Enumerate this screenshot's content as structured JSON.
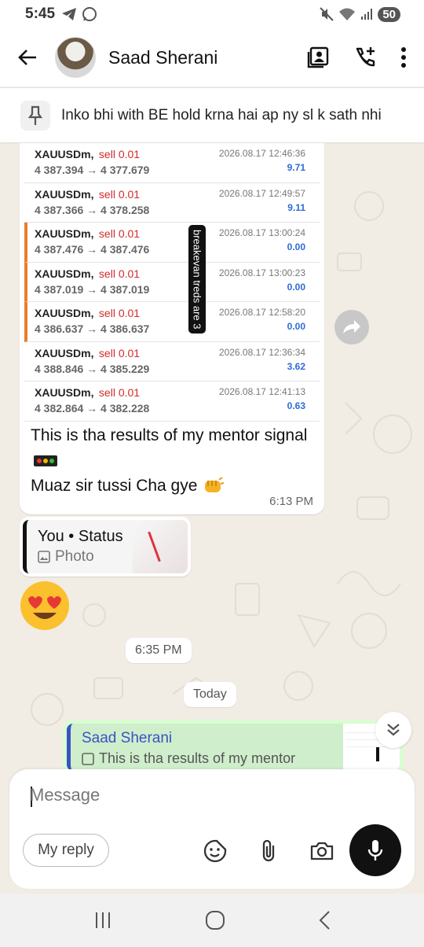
{
  "status_bar": {
    "time": "5:45",
    "battery": "50"
  },
  "header": {
    "contact_name": "Saad Sherani"
  },
  "pinned": {
    "text": "Inko bhi with BE hold krna hai ap ny sl k sath nhi"
  },
  "trades": [
    {
      "symbol": "XAUUSDm,",
      "side": "sell 0.01",
      "prices": "4 387.394 → 4 377.679",
      "date": "2026.08.17 12:46:36",
      "pnl": "9.71",
      "breakeven": false
    },
    {
      "symbol": "XAUUSDm,",
      "side": "sell 0.01",
      "prices": "4 387.366 → 4 378.258",
      "date": "2026.08.17 12:49:57",
      "pnl": "9.11",
      "breakeven": false
    },
    {
      "symbol": "XAUUSDm,",
      "side": "sell 0.01",
      "prices": "4 387.476 → 4 387.476",
      "date": "2026.08.17 13:00:24",
      "pnl": "0.00",
      "breakeven": true
    },
    {
      "symbol": "XAUUSDm,",
      "side": "sell 0.01",
      "prices": "4 387.019 → 4 387.019",
      "date": "2026.08.17 13:00:23",
      "pnl": "0.00",
      "breakeven": true
    },
    {
      "symbol": "XAUUSDm,",
      "side": "sell 0.01",
      "prices": "4 386.637 → 4 386.637",
      "date": "2026.08.17 12:58:20",
      "pnl": "0.00",
      "breakeven": true
    },
    {
      "symbol": "XAUUSDm,",
      "side": "sell 0.01",
      "prices": "4 388.846 → 4 385.229",
      "date": "2026.08.17 12:36:34",
      "pnl": "3.62",
      "breakeven": false
    },
    {
      "symbol": "XAUUSDm,",
      "side": "sell 0.01",
      "prices": "4 382.864 → 4 382.228",
      "date": "2026.08.17 12:41:13",
      "pnl": "0.63",
      "breakeven": false
    }
  ],
  "breakeven_label": "breakevan treds are 3",
  "message1": {
    "line1": "This is tha results of my mentor signal",
    "line2": "Muaz sir tussi Cha gye",
    "time": "6:13 PM"
  },
  "status_reply": {
    "title": "You • Status",
    "subtitle": "Photo"
  },
  "time_pill": "6:35 PM",
  "date_pill": "Today",
  "outgoing_quote": {
    "name": "Saad Sherani",
    "text": "This is tha results of my mentor"
  },
  "composer": {
    "placeholder": "Message",
    "my_reply": "My reply"
  },
  "colors": {
    "accent_green": "#d9fdd3",
    "quote_blue": "#3a52c4",
    "sell_red": "#d02b2b",
    "pnl_blue": "#2c6bd8",
    "be_orange": "#e87d2b"
  }
}
